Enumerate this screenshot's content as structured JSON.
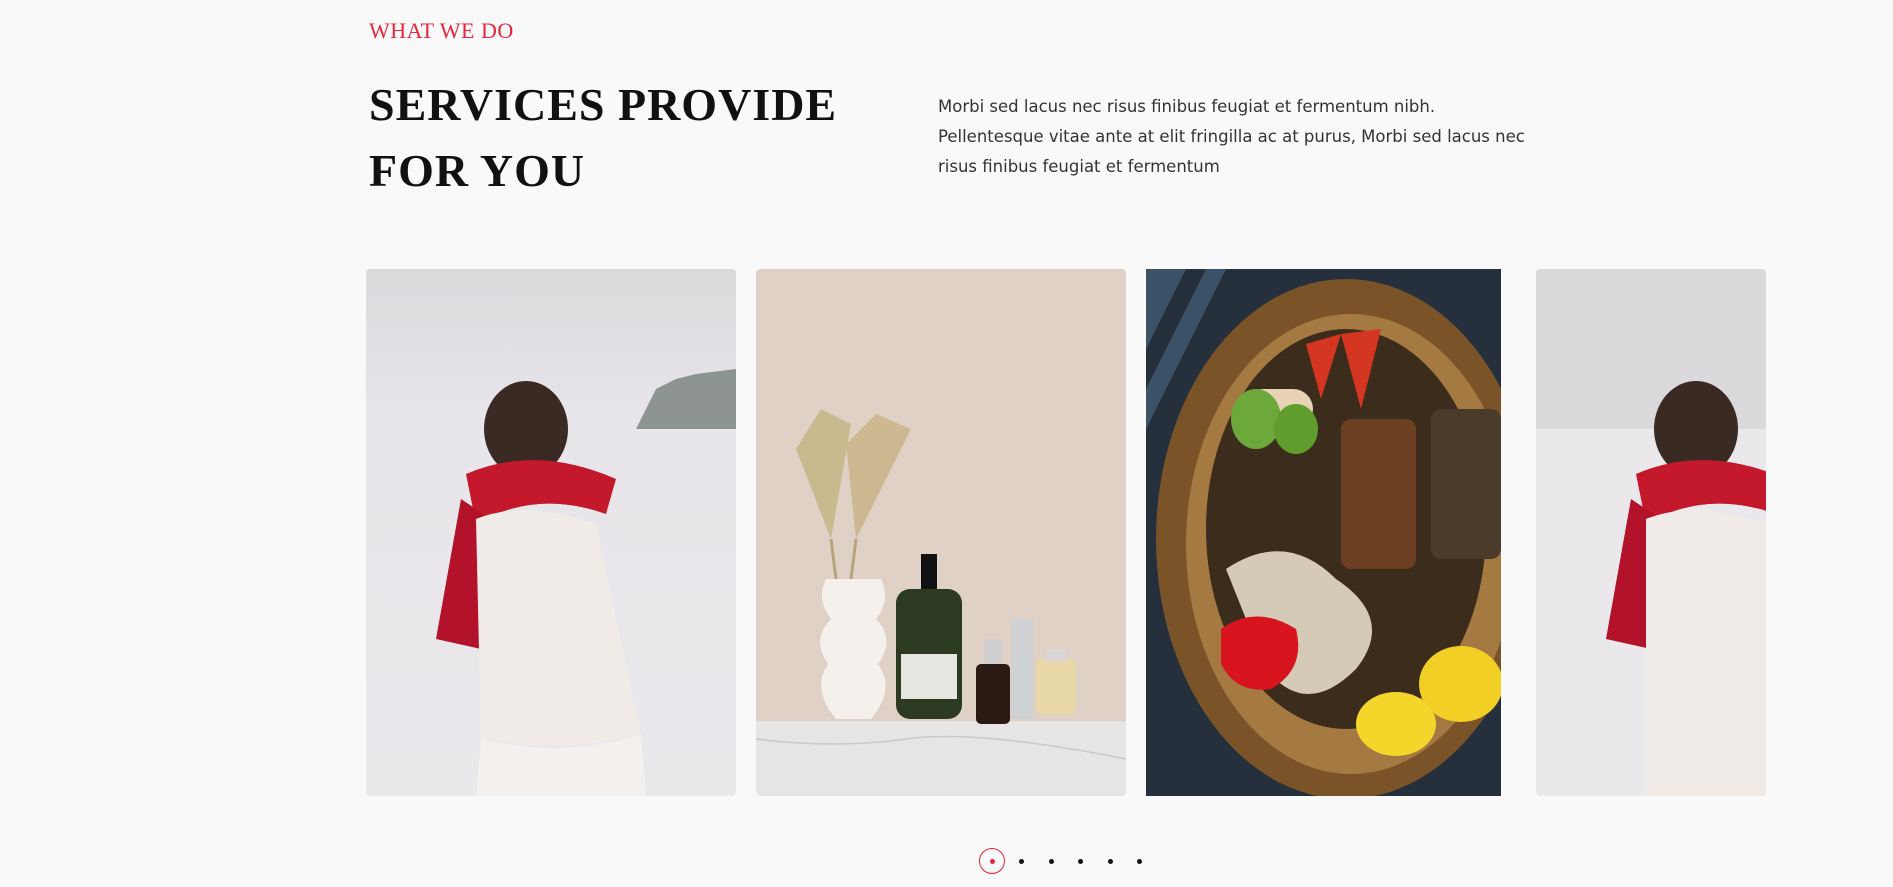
{
  "section": {
    "eyebrow": "WHAT WE DO",
    "heading_line1": "SERVICES PROVIDE",
    "heading_line2": "FOR YOU",
    "description": "Morbi sed lacus nec risus finibus feugiat et fermentum nibh. Pellentesque vitae ante at elit fringilla ac at purus, Morbi sed lacus nec risus finibus feugiat et fermentum"
  },
  "slides": [
    {
      "name": "woman-red-scarf-snow-photo"
    },
    {
      "name": "cosmetics-bottles-vase-photo"
    },
    {
      "name": "grocery-basket-photo"
    },
    {
      "name": "woman-red-scarf-snow-photo-clone"
    }
  ],
  "pagination": {
    "count": 6,
    "active_index": 0
  },
  "colors": {
    "accent": "#e8253e",
    "background": "#f9f9f9",
    "text": "#111111"
  }
}
